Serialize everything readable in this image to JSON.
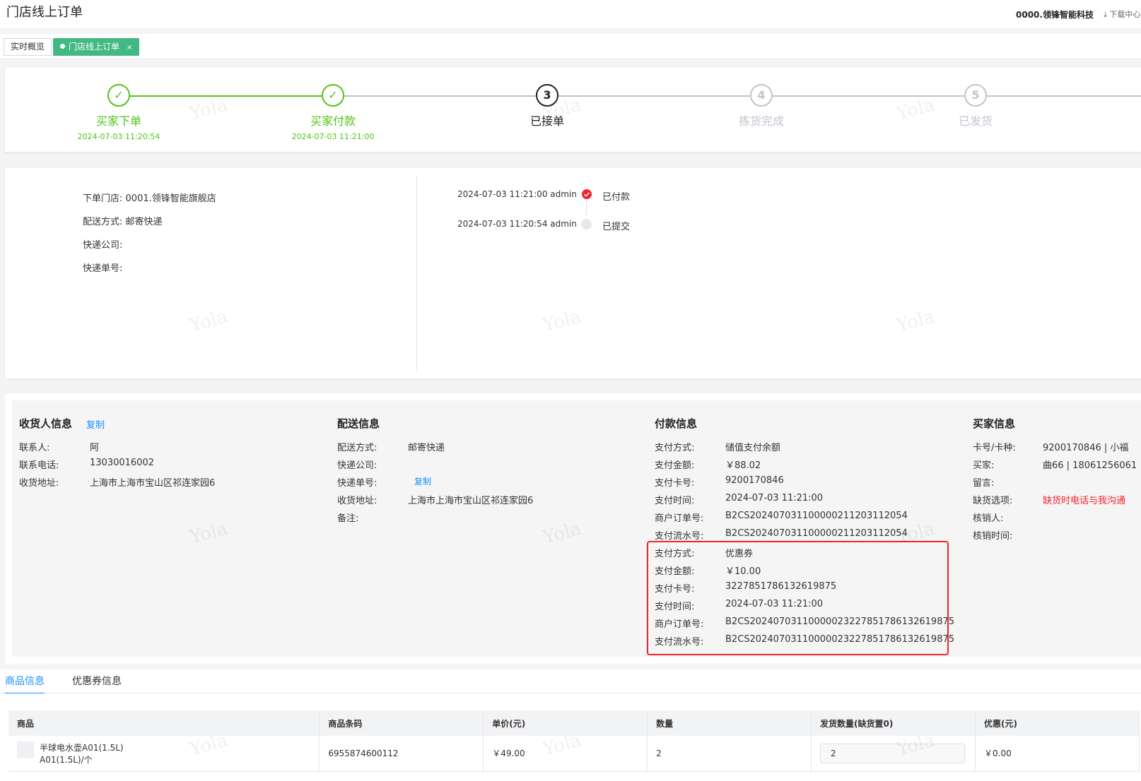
{
  "header": {
    "title": "门店线上订单",
    "org": "0000.领锋智能科技",
    "download": "⤓ 下载中心"
  },
  "tabs": [
    {
      "label": "实时概览",
      "active": false
    },
    {
      "label": "门店线上订单",
      "active": true,
      "close": "×"
    }
  ],
  "steps": [
    {
      "num": "✓",
      "title": "买家下单",
      "time": "2024-07-03 11:20:54",
      "state": "done"
    },
    {
      "num": "✓",
      "title": "买家付款",
      "time": "2024-07-03 11:21:00",
      "state": "done"
    },
    {
      "num": "3",
      "title": "已接单",
      "time": "",
      "state": "current"
    },
    {
      "num": "4",
      "title": "拣货完成",
      "time": "",
      "state": "todo"
    },
    {
      "num": "5",
      "title": "已发货",
      "time": "",
      "state": "todo"
    }
  ],
  "order_info": {
    "store_label": "下单门店:",
    "store": "0001.领锋智能旗舰店",
    "delivery_label": "配送方式:",
    "delivery": "邮寄快递",
    "express_label": "快递公司:",
    "express": "",
    "express_no_label": "快递单号:",
    "express_no": ""
  },
  "timeline": [
    {
      "time": "2024-07-03 11:21:00 admin",
      "status": "已付款",
      "active": true
    },
    {
      "time": "2024-07-03 11:20:54 admin",
      "status": "已提交",
      "active": false
    }
  ],
  "receiver": {
    "title": "收货人信息",
    "copy": "复制",
    "rows": [
      {
        "label": "联系人:",
        "value": "阿"
      },
      {
        "label": "联系电话:",
        "value": "13030016002"
      },
      {
        "label": "收货地址:",
        "value": "上海市上海市宝山区祁连家园6"
      }
    ]
  },
  "delivery": {
    "title": "配送信息",
    "rows": [
      {
        "label": "配送方式:",
        "value": "邮寄快递"
      },
      {
        "label": "快递公司:",
        "value": ""
      },
      {
        "label": "快递单号:",
        "value": "复制"
      },
      {
        "label": "收货地址:",
        "value": "上海市上海市宝山区祁连家园6"
      },
      {
        "label": "备注:",
        "value": ""
      }
    ]
  },
  "payment": {
    "title": "付款信息",
    "rows": [
      {
        "label": "支付方式:",
        "value": "储值支付余额"
      },
      {
        "label": "支付金额:",
        "value": "￥88.02"
      },
      {
        "label": "支付卡号:",
        "value": "9200170846"
      },
      {
        "label": "支付时间:",
        "value": "2024-07-03 11:21:00"
      },
      {
        "label": "商户订单号:",
        "value": "B2CS20240703110000021120311205​4"
      },
      {
        "label": "支付流水号:",
        "value": "B2CS20240703110000021120311205​4"
      },
      {
        "label": "支付方式:",
        "value": "优惠券"
      },
      {
        "label": "支付金额:",
        "value": "￥10.00"
      },
      {
        "label": "支付卡号:",
        "value": "3227851786132619875"
      },
      {
        "label": "支付时间:",
        "value": "2024-07-03 11:21:00"
      },
      {
        "label": "商户订单号:",
        "value": "B2CS202407031100000232278517861326198​75"
      },
      {
        "label": "支付流水号:",
        "value": "B2CS202407031100000232278517861326198​75"
      }
    ]
  },
  "buyer": {
    "title": "买家信息",
    "rows": [
      {
        "label": "卡号/卡种:",
        "value": "9200170846 | 小福"
      },
      {
        "label": "买家:",
        "value": "曲66 | 18061256061"
      },
      {
        "label": "留言:",
        "value": ""
      },
      {
        "label": "缺货选项:",
        "value": "缺货时电话与我沟通"
      },
      {
        "label": "核销人:",
        "value": ""
      },
      {
        "label": "核销时间:",
        "value": ""
      }
    ]
  },
  "bottom_tabs": [
    {
      "label": "商品信息",
      "active": true
    },
    {
      "label": "优惠券信息",
      "active": false
    }
  ],
  "goods_table": {
    "headers": [
      "商品",
      "商品条码",
      "单价(元)",
      "数量",
      "发货数量(缺货置0)",
      "优惠(元)"
    ],
    "rows": [
      {
        "name": "半球电水壶A01(1.5L)",
        "spec": "A01(1.5L)/个",
        "barcode": "6955874600112",
        "price": "￥49.00",
        "qty": "2",
        "ship_qty": "2",
        "discount": "￥0.00"
      }
    ]
  },
  "watermark": "Yola",
  "colors": {
    "success": "#52c41a",
    "primary": "#1890ff",
    "danger": "#f5222d",
    "tab_active": "#42b983"
  }
}
